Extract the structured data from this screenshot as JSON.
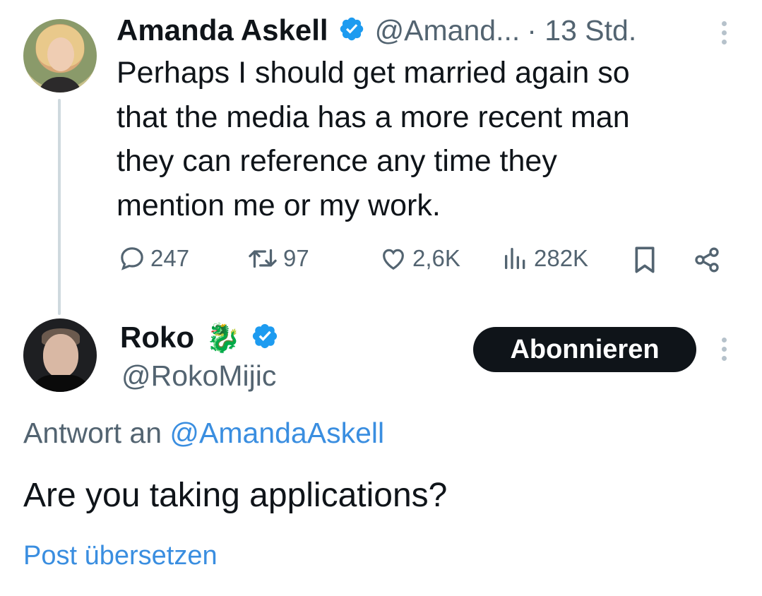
{
  "tweet": {
    "author_name": "Amanda Askell",
    "author_handle": "@Amand...",
    "time": "· 13 Std.",
    "text_lines": [
      "Perhaps I should get married again so",
      "that the media has a more recent man",
      "they can reference any time they",
      "mention me or my work."
    ],
    "actions": {
      "replies": "247",
      "reposts": "97",
      "likes": "2,6K",
      "views": "282K"
    }
  },
  "reply": {
    "author_name": "Roko",
    "author_emoji": "🐉",
    "author_handle": "@RokoMijic",
    "subscribe_label": "Abonnieren",
    "reply_to_prefix": "Antwort an",
    "reply_to_mention": "@AmandaAskell",
    "text": "Are you taking applications?",
    "translate_label": "Post übersetzen"
  },
  "colors": {
    "verified": "#1d9bf0",
    "link": "#3a8ee0",
    "muted": "#536471",
    "button_bg": "#0f1419"
  },
  "icons": [
    "verified-badge-icon",
    "more-icon",
    "reply-icon",
    "repost-icon",
    "like-icon",
    "views-icon",
    "bookmark-icon",
    "share-icon"
  ]
}
